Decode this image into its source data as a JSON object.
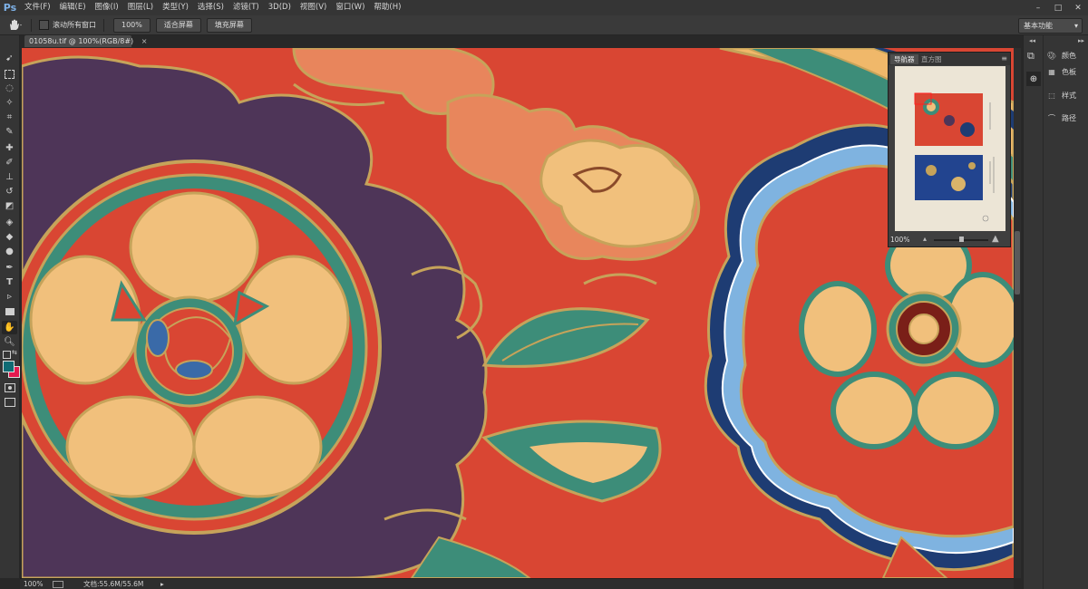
{
  "app": {
    "logo": "Ps"
  },
  "menu": [
    "文件(F)",
    "编辑(E)",
    "图像(I)",
    "图层(L)",
    "类型(Y)",
    "选择(S)",
    "滤镜(T)",
    "3D(D)",
    "视图(V)",
    "窗口(W)",
    "帮助(H)"
  ],
  "window_controls": {
    "minimize": "–",
    "maximize": "□",
    "close": "✕"
  },
  "options": {
    "scroll_all_label": "滚动所有窗口",
    "zoom_100": "100%",
    "fit_screen": "适合屏幕",
    "fill_screen": "填充屏幕",
    "workspace": "基本功能"
  },
  "document": {
    "tab_title": "01058u.tif @ 100%(RGB/8#)",
    "close": "×"
  },
  "status": {
    "zoom": "100%",
    "doc_info": "文档:55.6M/55.6M",
    "arrow": "▸"
  },
  "navigator": {
    "tab": "导航器",
    "tab2": "直方图",
    "zoom": "100%"
  },
  "dock": {
    "color": "颜色",
    "swatches": "色板",
    "styles": "样式",
    "paths": "路径"
  },
  "colors": {
    "foreground": "#0f6b74",
    "background": "#e4194f",
    "canvas_red": "#d94633",
    "gold": "#c6a35a"
  }
}
